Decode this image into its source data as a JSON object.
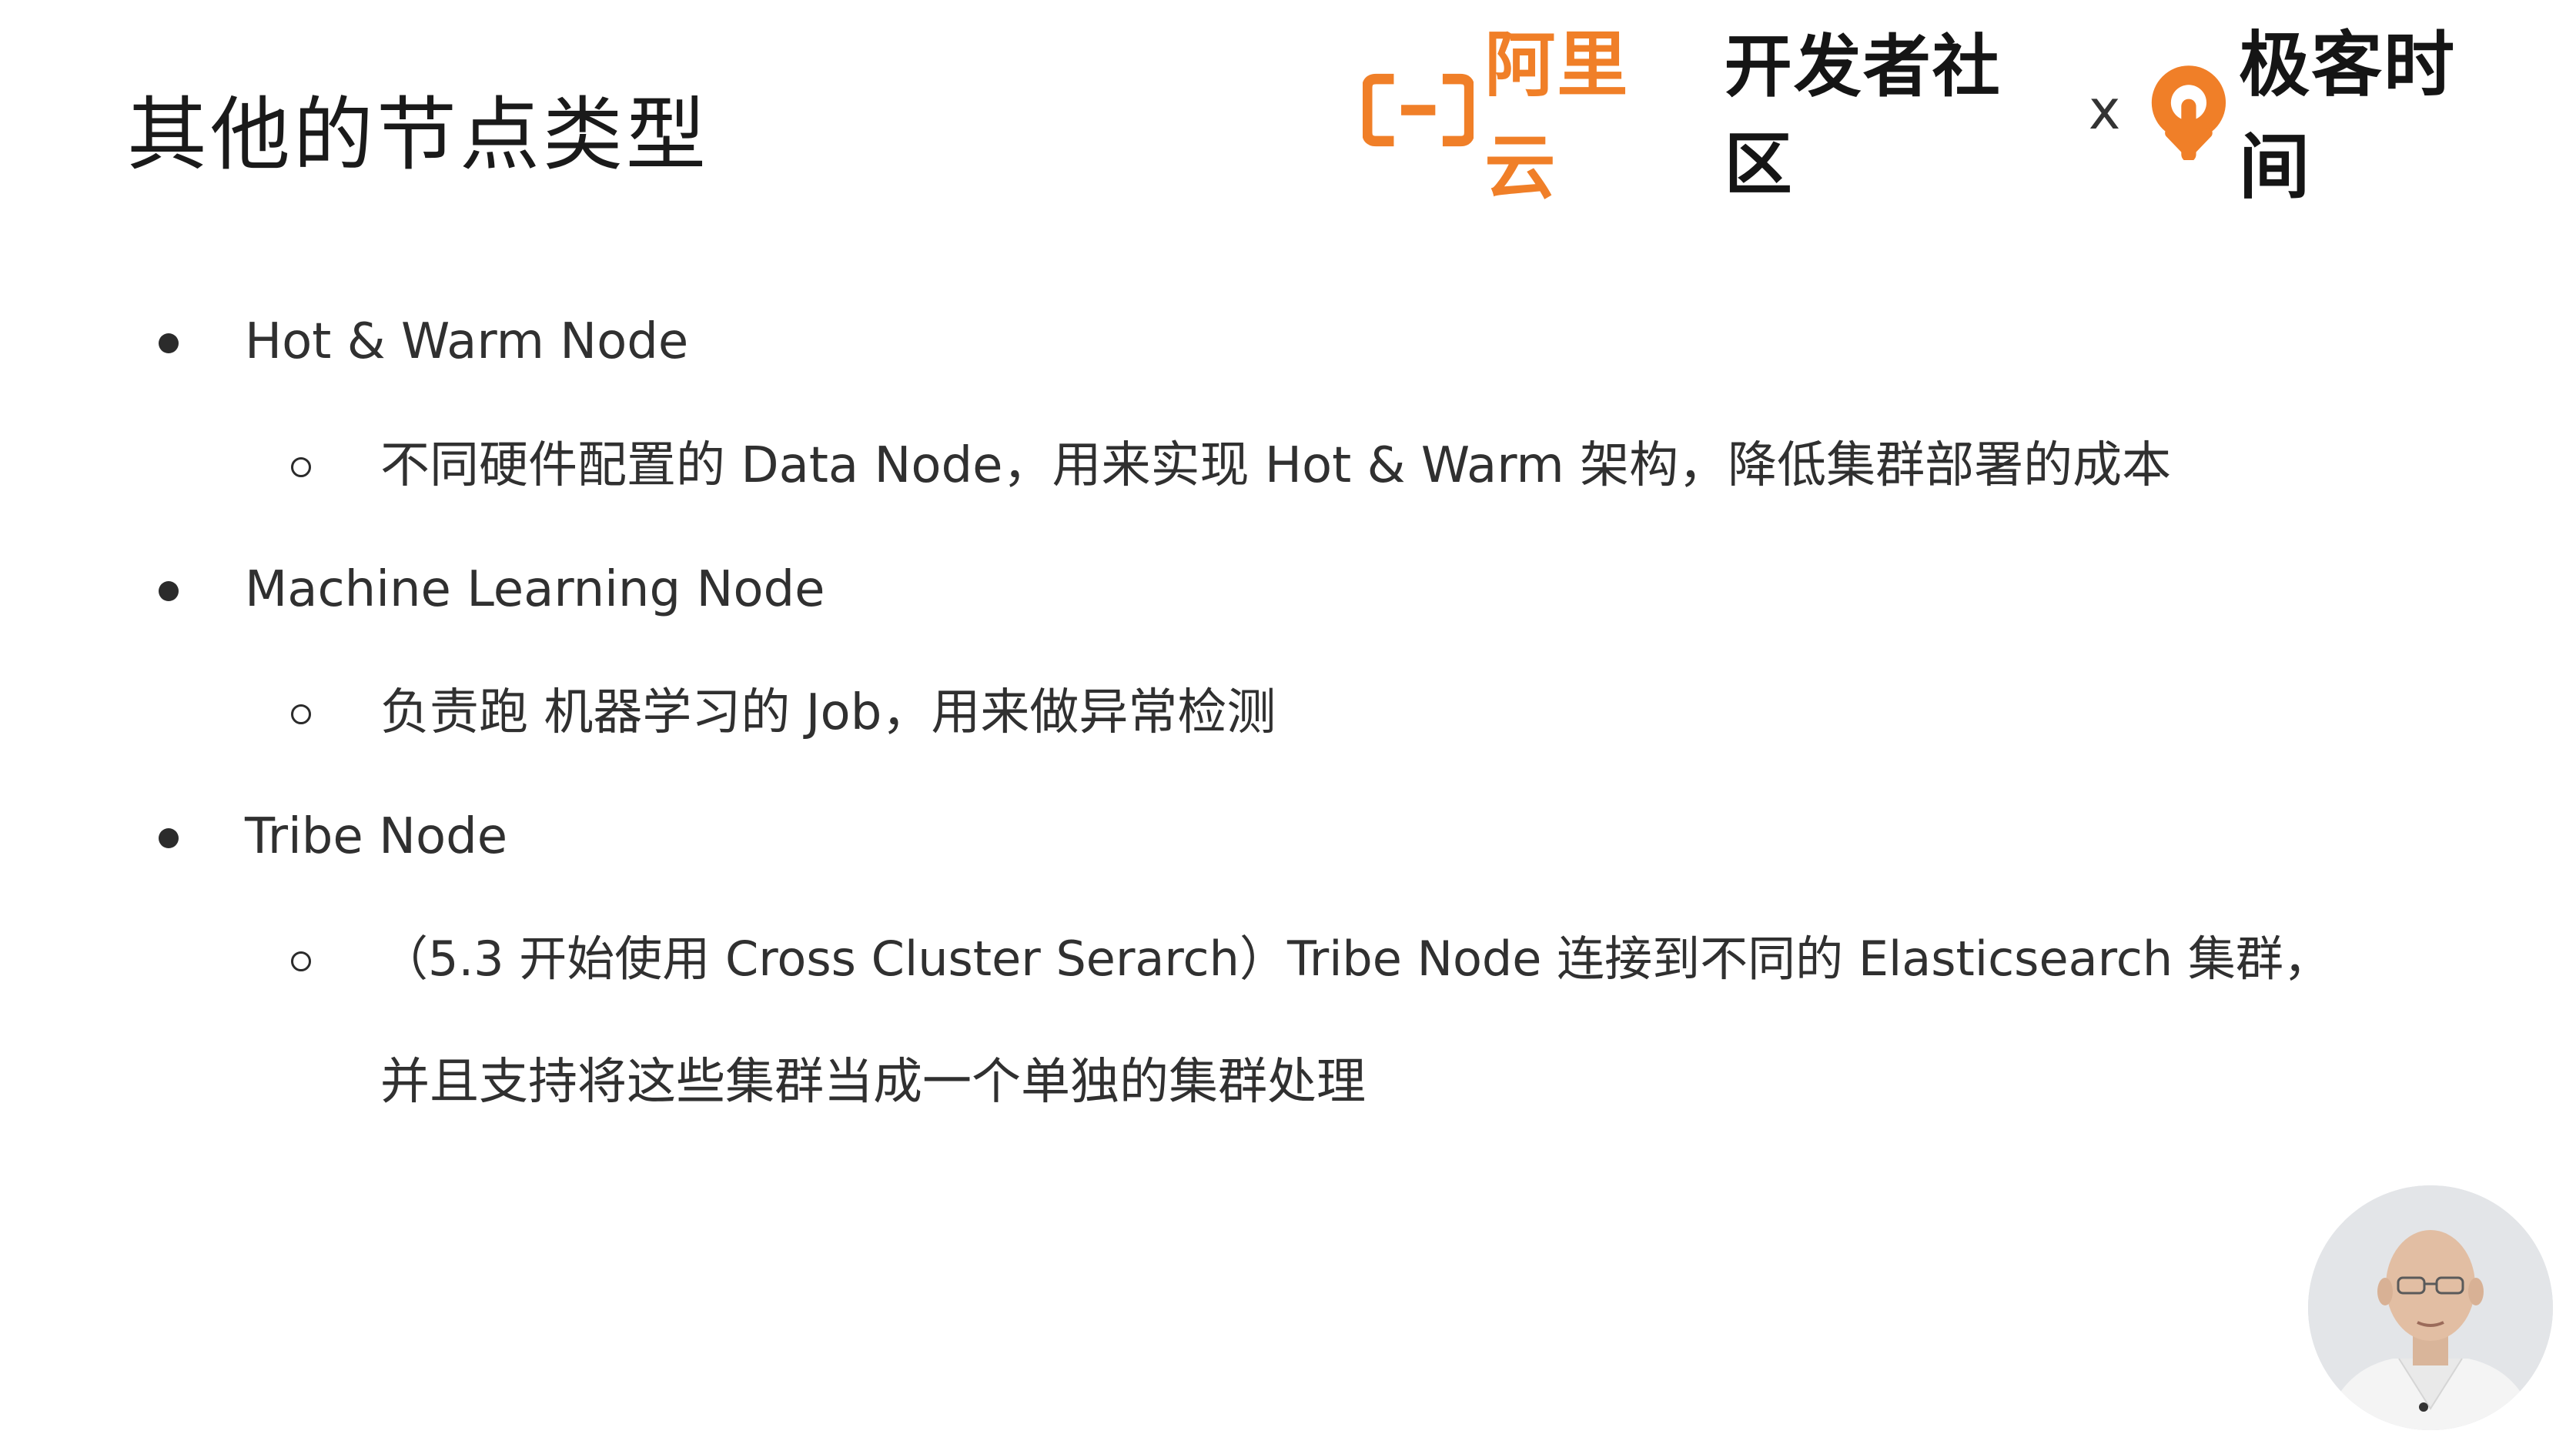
{
  "slide": {
    "title": "其他的节点类型",
    "logo": {
      "aliyun": "阿里云",
      "community": "开发者社区",
      "separator": "x",
      "geek": "极客时间"
    },
    "items": [
      {
        "text": "Hot & Warm Node",
        "sub": [
          "不同硬件配置的 Data Node，用来实现 Hot & Warm 架构，降低集群部署的成本"
        ]
      },
      {
        "text": "Machine Learning Node",
        "sub": [
          "负责跑 机器学习的 Job，用来做异常检测"
        ]
      },
      {
        "text": "Tribe Node",
        "sub": [
          "（5.3  开始使用 Cross Cluster Serarch）Tribe Node 连接到不同的 Elasticsearch 集群，",
          "并且支持将这些集群当成一个单独的集群处理"
        ]
      }
    ]
  },
  "colors": {
    "aliyun_orange": "#f07f28",
    "geek_orange": "#f07f28",
    "text": "#303030"
  },
  "icons": {
    "aliyun_logo": "aliyun-bracket-icon",
    "geek_logo": "geek-time-icon",
    "presenter": "presenter-video-thumbnail"
  }
}
